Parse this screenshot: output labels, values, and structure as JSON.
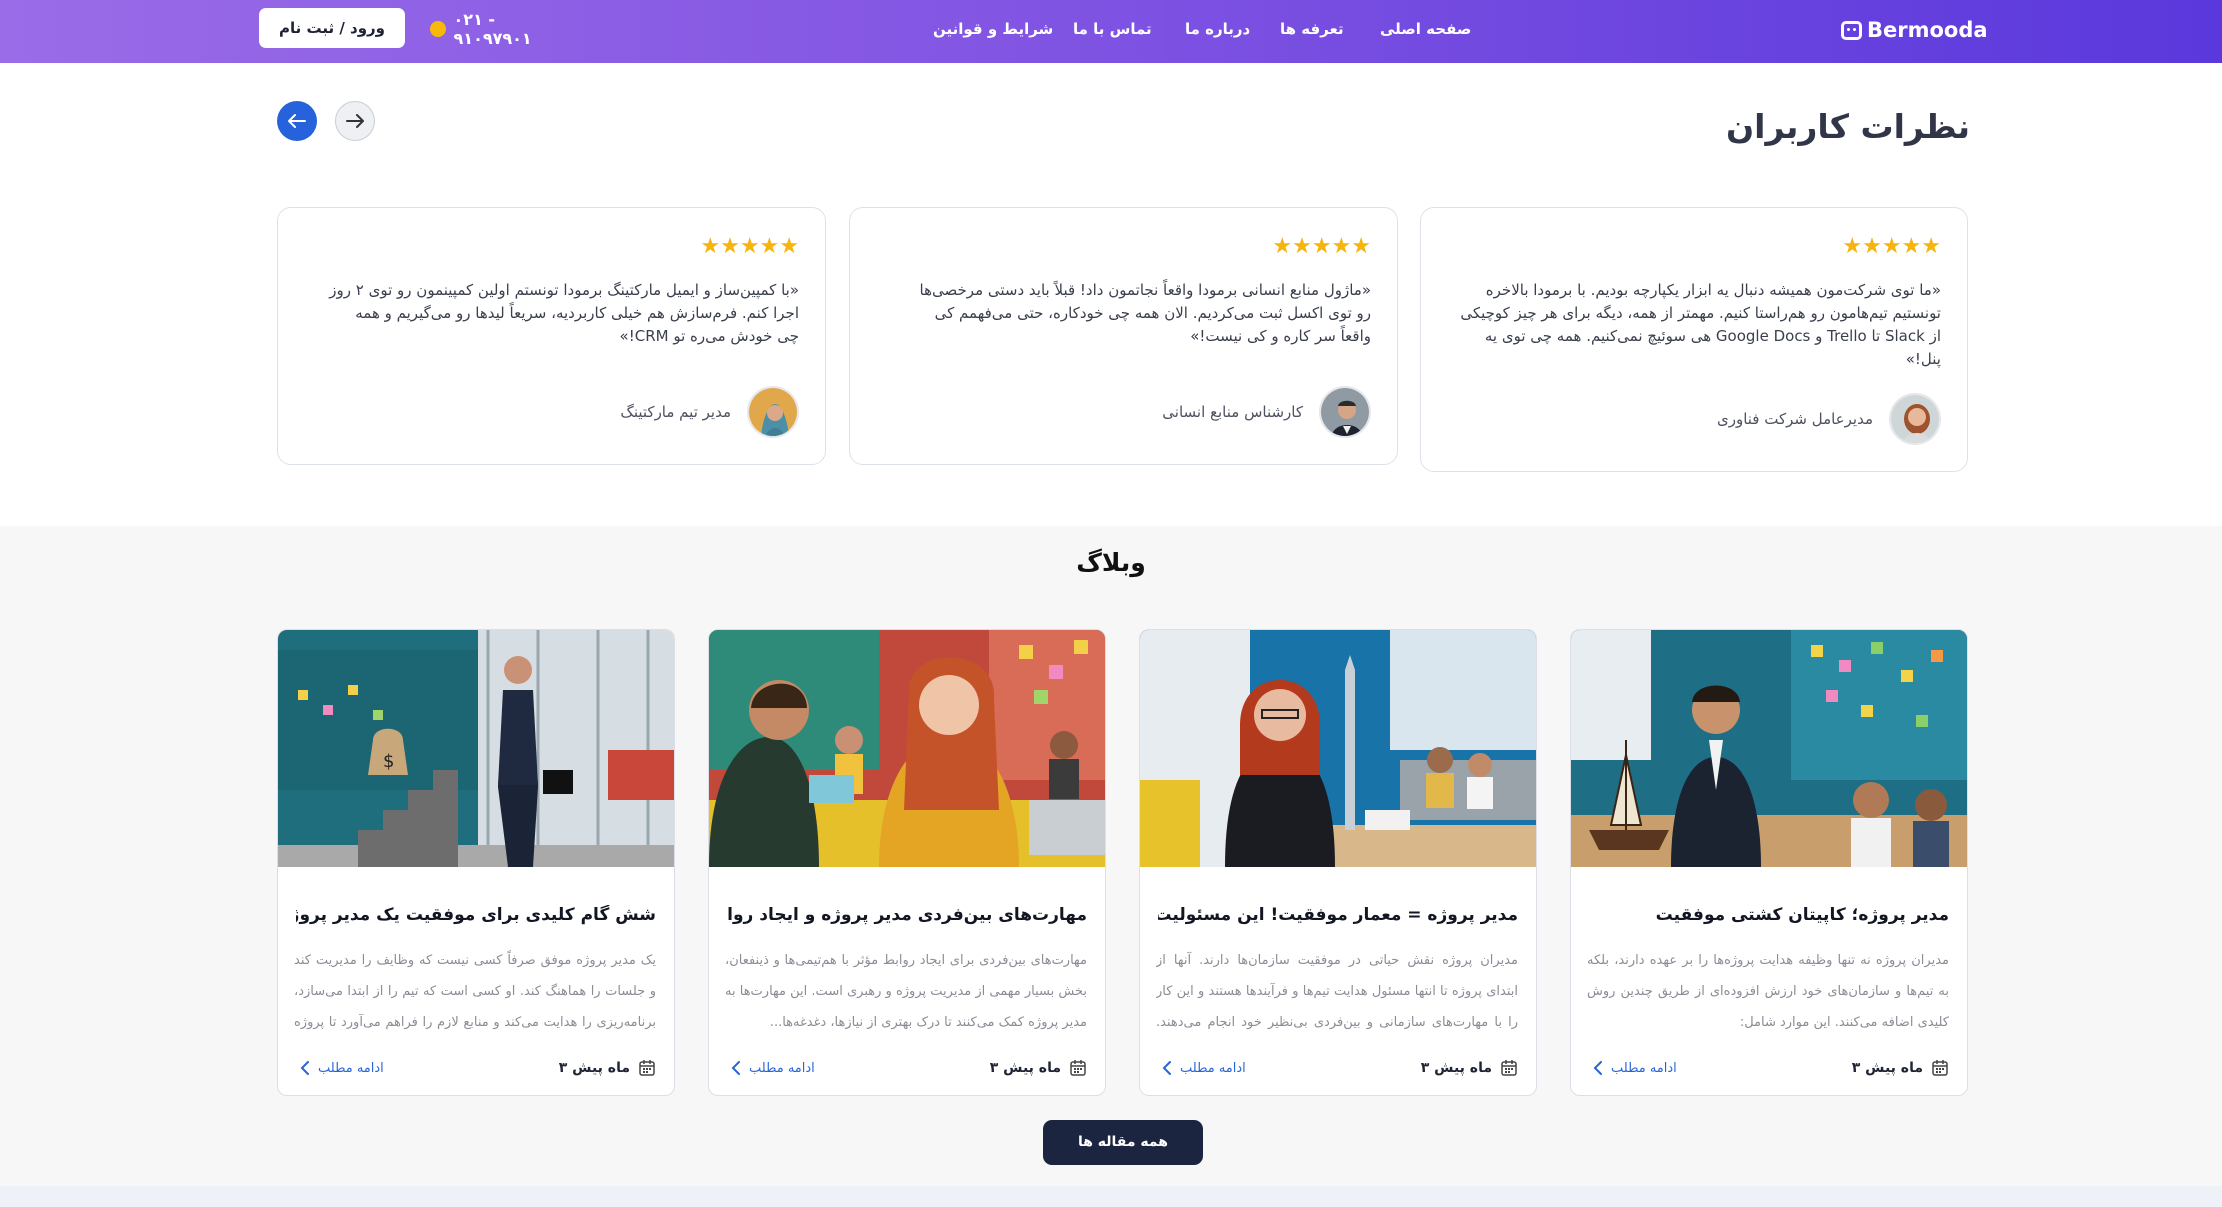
{
  "header": {
    "logo": "Bermooda",
    "menu": [
      "صفحه اصلی",
      "تعرفه ها",
      "درباره ما",
      "تماس با ما",
      "شرایط و قوانین"
    ],
    "phone": "۰۲۱ - ۹۱۰۹۷۹۰۱",
    "login": "ورود / ثبت نام"
  },
  "testimonials": {
    "title": "نظرات کاربران",
    "cards": [
      {
        "stars": "★★★★★",
        "quote": "«ما توی شرکت‌مون همیشه دنبال یه ابزار یکپارچه بودیم. با برمودا بالاخره تونستیم تیم‌هامون رو هم‌راستا کنیم. مهمتر از همه، دیگه برای هر چیز کوچیکی از Slack تا Trello و Google Docs هی سوئیچ نمی‌کنیم. همه چی توی یه پنل!»",
        "role": "مدیرعامل شرکت فناوری"
      },
      {
        "stars": "★★★★★",
        "quote": "«ماژول منابع انسانی برمودا واقعاً نجاتمون داد! قبلاً باید دستی مرخصی‌ها رو توی اکسل ثبت می‌کردیم. الان همه چی خودکاره، حتی می‌فهمم کی واقعاً سر کاره و کی نیست!»",
        "role": "کارشناس منابع انسانی"
      },
      {
        "stars": "★★★★★",
        "quote": "«با کمپین‌ساز و ایمیل مارکتینگ برمودا تونستم اولین کمپینمون رو توی ۲ روز اجرا کنم. فرم‌سازش هم خیلی کاربردیه، سریعاً لیدها رو می‌گیریم و همه چی خودش می‌ره تو CRM!»",
        "role": "مدیر تیم مارکتینگ"
      }
    ]
  },
  "blog": {
    "title": "وبلاگ",
    "posts": [
      {
        "title": "مدیر پروژه؛ کاپیتان کشتی موفقیت",
        "excerpt": "مدیران پروژه نه تنها وظیفه هدایت پروژه‌ها را بر عهده دارند، بلکه به تیم‌ها و سازمان‌های خود ارزش افزوده‌ای از طریق چندین روش کلیدی اضافه می‌کنند. این موارد شامل:",
        "date": "۳ ماه پیش",
        "more": "ادامه مطلب"
      },
      {
        "title": "مدیر پروژه = معمار موفقیت! این مسئولیت ها را...",
        "excerpt": "مدیران پروژه نقش حیاتی در موفقیت سازمان‌ها دارند. آنها از ابتدای پروژه تا انتها مسئول هدایت تیم‌ها و فرآیندها هستند و این کار را با مهارت‌های سازمانی و بین‌فردی بی‌نظیر خود انجام می‌دهند. پروژه...",
        "date": "۳ ماه پیش",
        "more": "ادامه مطلب"
      },
      {
        "title": "مهارت‌های بین‌فردی مدیر پروژه و ایجاد روابط",
        "excerpt": "مهارت‌های بین‌فردی برای ایجاد روابط مؤثر با هم‌تیمی‌ها و ذینفعان، بخش بسیار مهمی از مدیریت پروژه و رهبری است. این مهارت‌ها به مدیر پروژه کمک می‌کنند تا درک بهتری از نیازها، دغدغه‌ها...",
        "date": "۳ ماه پیش",
        "more": "ادامه مطلب"
      },
      {
        "title": "شش گام کلیدی برای موفقیت یک مدیر پروژه",
        "excerpt": "یک مدیر پروژه موفق صرفاً کسی نیست که وظایف را مدیریت کند و جلسات را هماهنگ کند. او کسی است که تیم را از ابتدا می‌سازد، برنامه‌ریزی را هدایت می‌کند و منابع لازم را فراهم می‌آورد تا پروژه ...",
        "date": "۳ ماه پیش",
        "more": "ادامه مطلب"
      }
    ],
    "all_button": "همه مقاله ها"
  }
}
